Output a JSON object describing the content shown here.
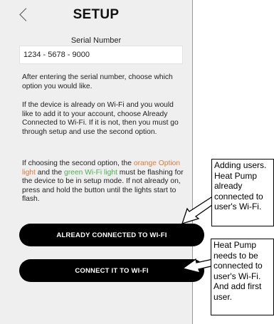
{
  "header": {
    "title": "SETUP",
    "back_icon": "chevron-left-icon"
  },
  "serial": {
    "label": "Serial Number",
    "value": "1234 - 5678 - 9000"
  },
  "instructions": {
    "p1": "After entering the serial number, choose which option you would like.",
    "p2": "If the device is already on Wi-Fi and you would like to add it to your account, choose Already Connected to Wi-Fi. If it is not, then you must go through setup and use the second option.",
    "p3_part1": "If choosing the second option, the ",
    "p3_orange": "orange Option light",
    "p3_part2": "  and the ",
    "p3_green": "green Wi-Fi light",
    "p3_part3": " must be flashing for the device to be in setup mode. If not already on, press and hold the button until the lights start to flash."
  },
  "buttons": {
    "already_connected": "ALREADY CONNECTED TO WI-FI",
    "connect": "CONNECT IT TO WI-FI"
  },
  "annotations": {
    "note1": "Adding users. Heat Pump already connected to user's Wi-Fi.",
    "note2": "Heat Pump needs to be connected to user's Wi-Fi. And add first user."
  },
  "colors": {
    "orange_text": "#e07a3a",
    "green_text": "#4caf50",
    "button_bg": "#000000",
    "screen_bg": "#efefef"
  }
}
